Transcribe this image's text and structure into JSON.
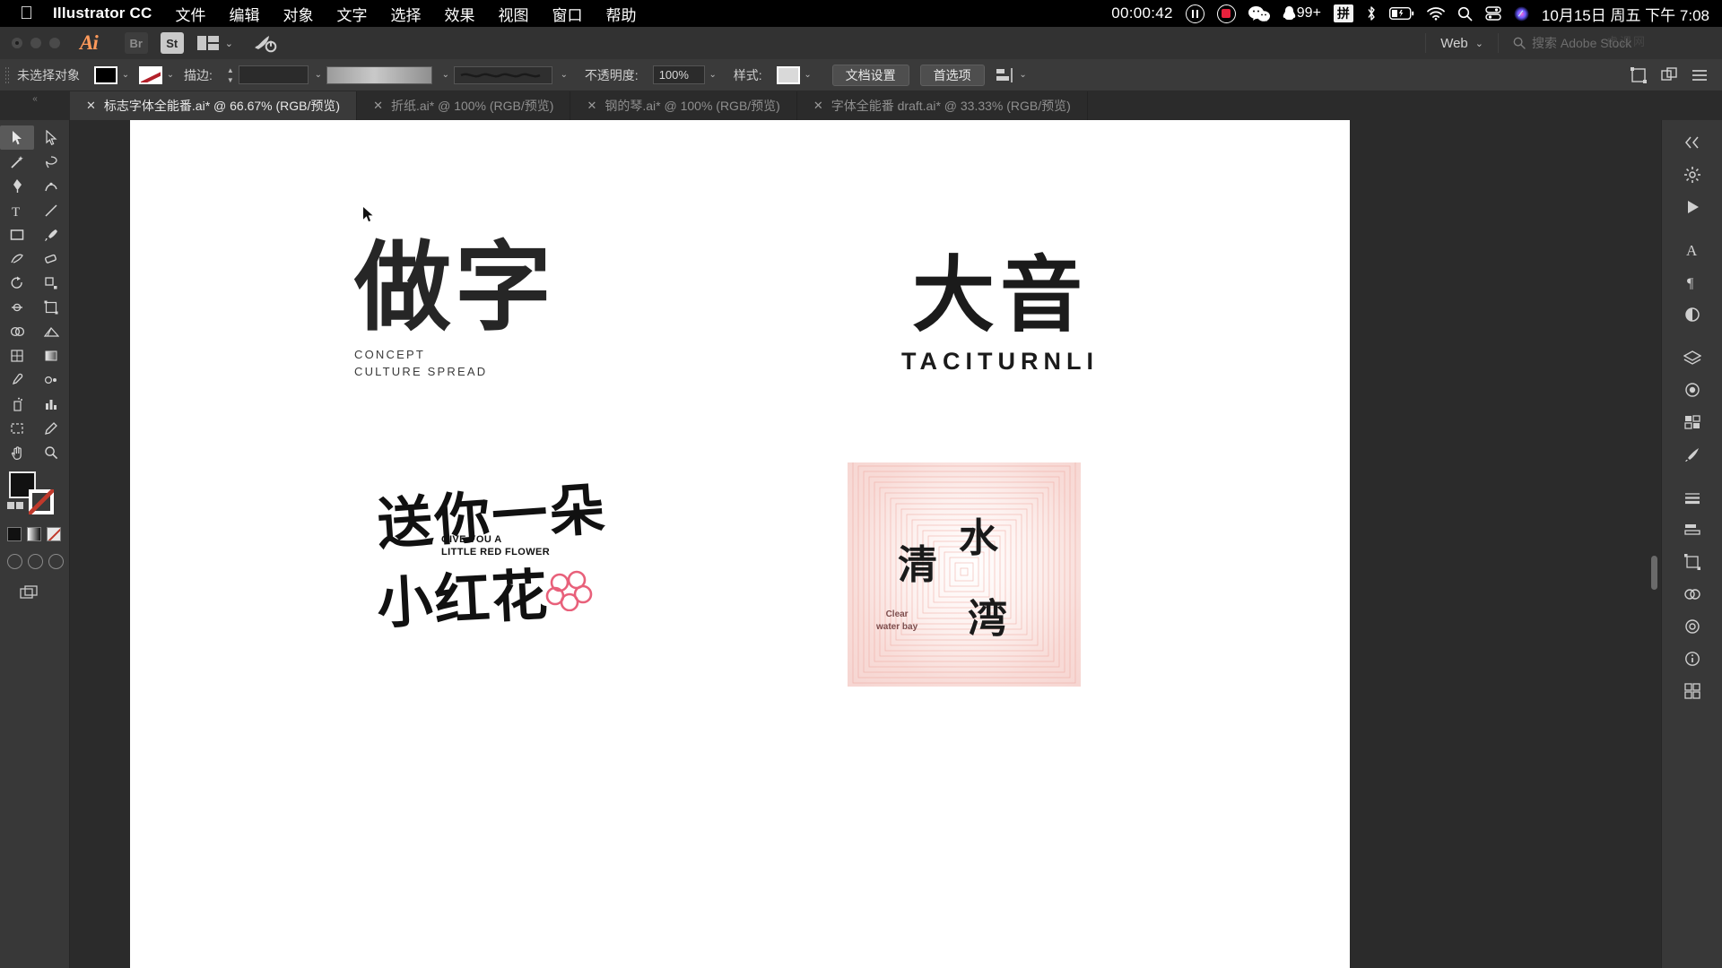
{
  "menubar": {
    "apple_icon": "apple-logo-icon",
    "app_name": "Illustrator CC",
    "items": [
      "文件",
      "编辑",
      "对象",
      "文字",
      "选择",
      "效果",
      "视图",
      "窗口",
      "帮助"
    ],
    "recording_timer": "00:00:42",
    "pause_icon": "pause-icon",
    "record_icon": "record-icon",
    "wechat_icon": "wechat-icon",
    "qq_icon": "qq-icon",
    "qq_badge": "99+",
    "ime_label": "拼",
    "bluetooth_icon": "bluetooth-icon",
    "battery_icon": "battery-charging-icon",
    "wifi_icon": "wifi-icon",
    "spotlight_icon": "search-icon",
    "controlcenter_icon": "control-center-icon",
    "siri_icon": "siri-icon",
    "datetime": "10月15日 周五 下午 7:08"
  },
  "appbar": {
    "ai_logo": "Ai",
    "bridge_label": "Br",
    "stock_label": "St",
    "arrange_icon": "arrange-documents-icon",
    "arrange_chevron": "⌄",
    "rocket_icon": "rocket-power-icon",
    "workspace": "Web",
    "workspace_chevron": "⌄",
    "search_placeholder": "搜索 Adobe Stock",
    "search_icon": "search-stock-icon"
  },
  "controlbar": {
    "selection_status": "未选择对象",
    "fill_label": "fill-swatch",
    "stroke_label": "stroke-swatch",
    "stroke_text": "描边:",
    "stroke_weight_value": "",
    "stroke_profile": "stroke-profile-preview",
    "opacity_label": "不透明度:",
    "opacity_value": "100%",
    "style_label": "样式:",
    "document_setup": "文档设置",
    "preferences": "首选项",
    "align_icon": "align-objects-icon",
    "transform_icon": "transform-icon",
    "arrange_icon": "arrange-icon",
    "menu_icon": "panel-menu-icon"
  },
  "tabs": [
    {
      "title": "标志字体全能番.ai* @ 66.67% (RGB/预览)",
      "active": true,
      "close_icon": "close-icon"
    },
    {
      "title": "折纸.ai* @ 100% (RGB/预览)",
      "active": false,
      "close_icon": "close-icon"
    },
    {
      "title": "钢的琴.ai* @ 100% (RGB/预览)",
      "active": false,
      "close_icon": "close-icon"
    },
    {
      "title": "字体全能番 draft.ai* @ 33.33% (RGB/预览)",
      "active": false,
      "close_icon": "close-icon"
    }
  ],
  "toolbar": {
    "tools": [
      {
        "name": "selection-tool",
        "selected": true
      },
      {
        "name": "direct-selection-tool",
        "selected": false
      },
      {
        "name": "magic-wand-tool",
        "selected": false
      },
      {
        "name": "lasso-tool",
        "selected": false
      },
      {
        "name": "pen-tool",
        "selected": false
      },
      {
        "name": "curvature-tool",
        "selected": false
      },
      {
        "name": "type-tool",
        "selected": false
      },
      {
        "name": "line-segment-tool",
        "selected": false
      },
      {
        "name": "rectangle-tool",
        "selected": false
      },
      {
        "name": "paintbrush-tool",
        "selected": false
      },
      {
        "name": "shaper-tool",
        "selected": false
      },
      {
        "name": "eraser-tool",
        "selected": false
      },
      {
        "name": "rotate-tool",
        "selected": false
      },
      {
        "name": "scale-tool",
        "selected": false
      },
      {
        "name": "width-tool",
        "selected": false
      },
      {
        "name": "free-transform-tool",
        "selected": false
      },
      {
        "name": "shape-builder-tool",
        "selected": false
      },
      {
        "name": "perspective-grid-tool",
        "selected": false
      },
      {
        "name": "mesh-tool",
        "selected": false
      },
      {
        "name": "gradient-tool",
        "selected": false
      },
      {
        "name": "eyedropper-tool",
        "selected": false
      },
      {
        "name": "blend-tool",
        "selected": false
      },
      {
        "name": "symbol-sprayer-tool",
        "selected": false
      },
      {
        "name": "column-graph-tool",
        "selected": false
      },
      {
        "name": "artboard-tool",
        "selected": false
      },
      {
        "name": "slice-tool",
        "selected": false
      },
      {
        "name": "hand-tool",
        "selected": false
      },
      {
        "name": "zoom-tool",
        "selected": false
      }
    ],
    "fill_color": "#111111",
    "stroke_color": "#ffffff",
    "color_mode_icons": [
      "color-icon",
      "gradient-icon",
      "none-icon"
    ],
    "screen_mode_icons": [
      "normal-screen-icon",
      "full-screen-menu-icon",
      "full-screen-icon"
    ],
    "edit_toolbar_icon": "edit-toolbar-icon"
  },
  "canvas": {
    "cursor": "arrow-cursor",
    "artwork": [
      {
        "id": "logo-zuozi",
        "main_text": "做字",
        "sub_line1": "CONCEPT",
        "sub_line2": "CULTURE SPREAD"
      },
      {
        "id": "logo-dayin",
        "main_text": "大音",
        "sub_text": "TACITURNLI"
      },
      {
        "id": "logo-red-flower",
        "line1": "送你一朵",
        "line2": "小红花",
        "en_line1": "GIVE YOU A",
        "en_line2": "LITTLE RED FLOWER",
        "flower_icon": "flower-icon",
        "flower_color": "#e8607a"
      },
      {
        "id": "logo-clear-water-bay",
        "chars": [
          "清",
          "水",
          "湾"
        ],
        "en_line1": "Clear",
        "en_line2": "water bay",
        "bg_color": "#f8dcd8",
        "text_color": "#7d4d4d"
      }
    ]
  },
  "rightpanel": {
    "icons": [
      "panel-collapse-icon",
      "properties-gear-icon",
      "libraries-play-icon",
      "character-icon",
      "paragraph-icon",
      "opacity-icon",
      "layers-icon",
      "gradient-panel-icon",
      "swatches-icon",
      "brushes-icon",
      "symbols-icon",
      "stroke-panel-icon",
      "align-panel-icon",
      "transform-panel-icon",
      "pathfinder-icon",
      "appearance-icon",
      "info-icon",
      "artboards-icon"
    ]
  },
  "watermark": "虎课网"
}
